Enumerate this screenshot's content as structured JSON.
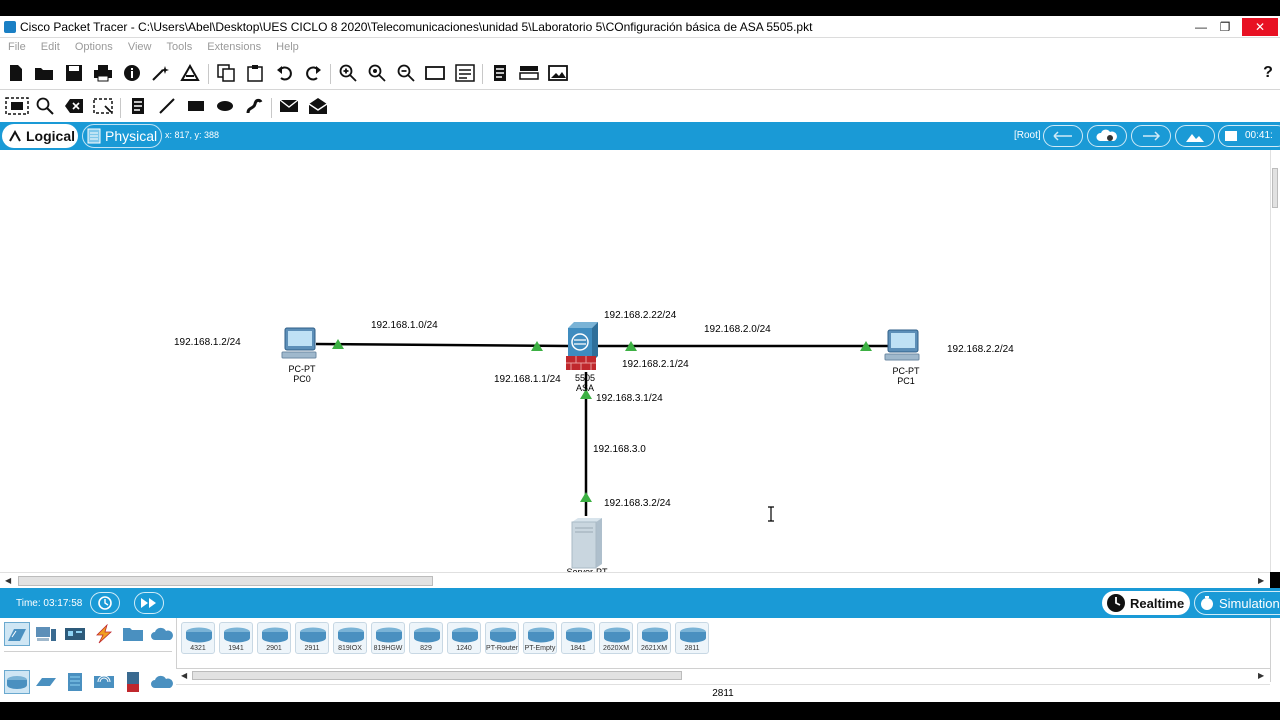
{
  "window": {
    "title": "Cisco Packet Tracer - C:\\Users\\Abel\\Desktop\\UES CICLO 8 2020\\Telecomunicaciones\\unidad 5\\Laboratorio 5\\COnfiguración básica de ASA 5505.pkt",
    "min": "—",
    "restore": "❐",
    "close": "✕"
  },
  "menu": [
    "File",
    "Edit",
    "Options",
    "View",
    "Tools",
    "Extensions",
    "Help"
  ],
  "toolbar": {
    "help": "?"
  },
  "viewbar": {
    "logical": "Logical",
    "physical": "Physical",
    "coords": "x: 817, y: 388",
    "root": "[Root]",
    "clock": "00:41:"
  },
  "topology": {
    "pc0": {
      "type": "PC-PT",
      "name": "PC0",
      "ip": "192.168.1.2/24"
    },
    "pc1": {
      "type": "PC-PT",
      "name": "PC1",
      "ip": "192.168.2.2/24"
    },
    "asa": {
      "model": "5505",
      "name": "ASA"
    },
    "server": {
      "label": "Server-PT"
    },
    "net1": "192.168.1.0/24",
    "net2": "192.168.2.0/24",
    "net3": "192.168.3.0",
    "asa_if1": "192.168.1.1/24",
    "asa_if2_top": "192.168.2.22/24",
    "asa_if2": "192.168.2.1/24",
    "asa_if3": "192.168.3.1/24",
    "server_ip": "192.168.3.2/24"
  },
  "timebar": {
    "time": "Time: 03:17:58",
    "realtime": "Realtime",
    "simulation": "Simulation"
  },
  "devices": {
    "models": [
      "4321",
      "1941",
      "2901",
      "2911",
      "819IOX",
      "819HGW",
      "829",
      "1240",
      "PT-Router",
      "PT-Empty",
      "1841",
      "2620XM",
      "2621XM",
      "2811"
    ],
    "selected_name": "2811"
  },
  "colors": {
    "accent": "#1a9ad6",
    "link_up": "#3cb043",
    "firewall": "#c0282d"
  }
}
